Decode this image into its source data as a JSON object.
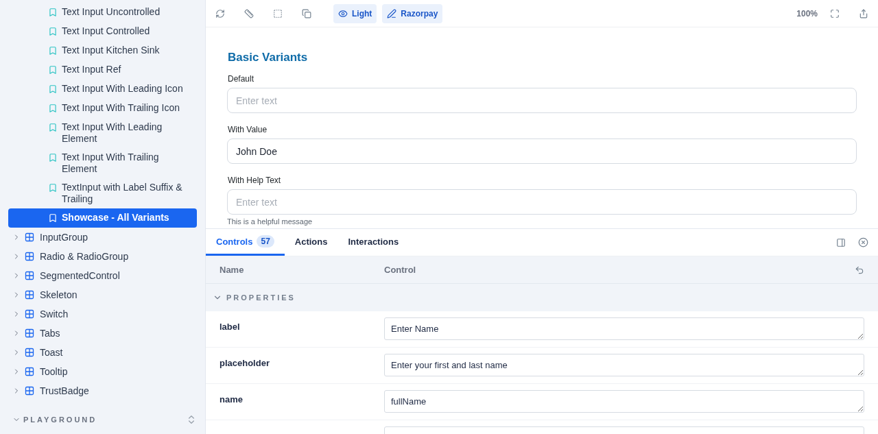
{
  "sidebar": {
    "stories": [
      {
        "label": "Text Input Uncontrolled",
        "selected": false
      },
      {
        "label": "Text Input Controlled",
        "selected": false
      },
      {
        "label": "Text Input Kitchen Sink",
        "selected": false
      },
      {
        "label": "Text Input Ref",
        "selected": false
      },
      {
        "label": "Text Input With Leading Icon",
        "selected": false
      },
      {
        "label": "Text Input With Trailing Icon",
        "selected": false
      },
      {
        "label": "Text Input With Leading Element",
        "selected": false
      },
      {
        "label": "Text Input With Trailing Element",
        "selected": false
      },
      {
        "label": "TextInput with Label Suffix & Trailing",
        "selected": false
      },
      {
        "label": "Showcase - All Variants",
        "selected": true
      }
    ],
    "components": [
      {
        "label": "InputGroup",
        "expanded": false
      },
      {
        "label": "Radio & RadioGroup",
        "expanded": false
      },
      {
        "label": "SegmentedControl",
        "expanded": false
      },
      {
        "label": "Skeleton",
        "expanded": false
      },
      {
        "label": "Switch",
        "expanded": false
      },
      {
        "label": "Tabs",
        "expanded": false
      },
      {
        "label": "Toast",
        "expanded": false
      },
      {
        "label": "Tooltip",
        "expanded": false
      },
      {
        "label": "TrustBadge",
        "expanded": false
      }
    ],
    "section": {
      "title": "PLAYGROUND",
      "expanded": true
    }
  },
  "toolbar": {
    "buttons": [
      {
        "kind": "eye",
        "label": "Light"
      },
      {
        "kind": "brush",
        "label": "Razorpay"
      }
    ],
    "zoom": "100%"
  },
  "preview": {
    "heading": "Basic Variants",
    "fields": [
      {
        "label": "Default",
        "placeholder": "Enter text"
      },
      {
        "label": "With Value",
        "value": "John Doe"
      },
      {
        "label": "With Help Text",
        "placeholder": "Enter text",
        "help": "This is a helpful message"
      }
    ]
  },
  "panel": {
    "tabs": [
      {
        "label": "Controls",
        "count": "57",
        "selected": true
      },
      {
        "label": "Actions",
        "selected": false
      },
      {
        "label": "Interactions",
        "selected": false
      }
    ],
    "columns": [
      "Name",
      "Control"
    ],
    "section": {
      "title": "PROPERTIES",
      "expanded": true
    },
    "rows": [
      {
        "kind": "text",
        "name": "label",
        "value": "Enter Name"
      },
      {
        "kind": "text",
        "name": "placeholder",
        "value": "Enter your first and last name"
      },
      {
        "kind": "text",
        "name": "name",
        "value": "fullName"
      },
      {
        "kind": "cut"
      }
    ]
  }
}
